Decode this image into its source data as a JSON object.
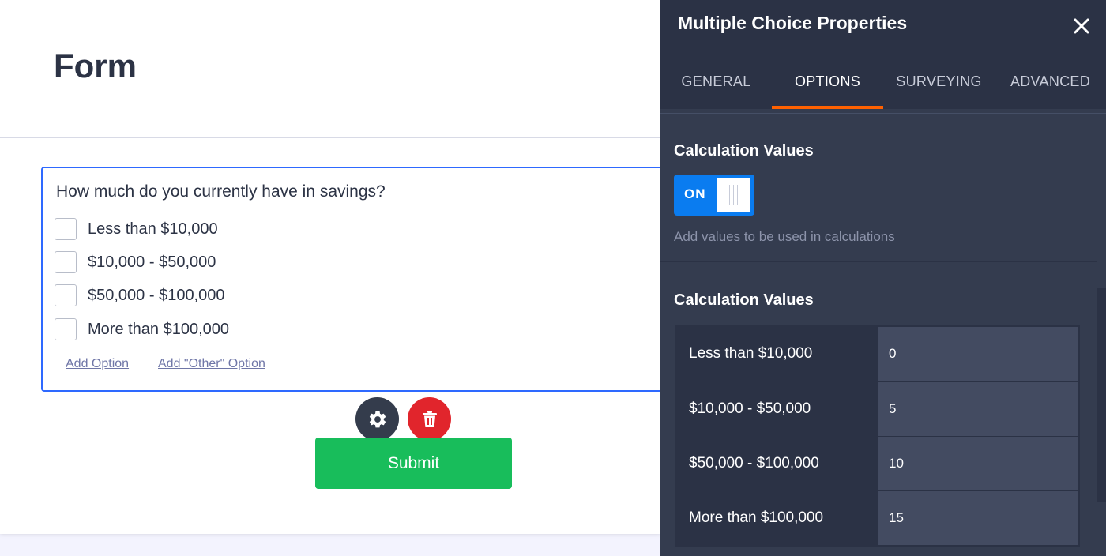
{
  "form": {
    "title": "Form",
    "question": {
      "label": "How much do you currently have in savings?",
      "options": [
        "Less than $10,000",
        "$10,000 - $50,000",
        "$50,000 - $100,000",
        "More than $100,000"
      ],
      "add_option": "Add Option",
      "add_other_option": "Add \"Other\" Option"
    },
    "submit_label": "Submit"
  },
  "panel": {
    "title": "Multiple Choice Properties",
    "tabs": [
      {
        "label": "GENERAL",
        "active": false
      },
      {
        "label": "OPTIONS",
        "active": true
      },
      {
        "label": "SURVEYING",
        "active": false
      },
      {
        "label": "ADVANCED",
        "active": false
      }
    ],
    "calc_toggle": {
      "title": "Calculation Values",
      "state": "ON",
      "description": "Add values to be used in calculations"
    },
    "calc_values": {
      "title": "Calculation Values",
      "rows": [
        {
          "label": "Less than $10,000",
          "value": "0"
        },
        {
          "label": "$10,000 - $50,000",
          "value": "5"
        },
        {
          "label": "$50,000 - $100,000",
          "value": "10"
        },
        {
          "label": "More than $100,000",
          "value": "15"
        }
      ]
    }
  },
  "colors": {
    "accent_blue": "#2e69ff",
    "toggle_on": "#0a7cf0",
    "tab_active_underline": "#ff6100",
    "submit_green": "#18bd5b",
    "delete_red": "#e1252c",
    "panel_bg": "#343c4f"
  },
  "icons": {
    "close": "close-icon",
    "gear": "gear-icon",
    "trash": "trash-icon"
  }
}
